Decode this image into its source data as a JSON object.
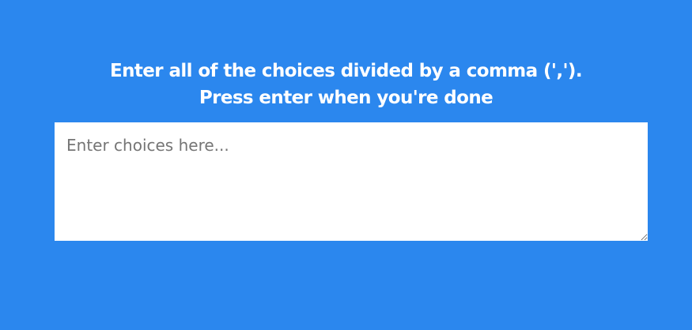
{
  "prompt": {
    "line1": "Enter all of the choices divided by a comma (',').",
    "line2": "Press enter when you're done"
  },
  "choices_input": {
    "value": "",
    "placeholder": "Enter choices here..."
  },
  "colors": {
    "background": "#2b87ee",
    "text": "#ffffff",
    "input_background": "#ffffff",
    "placeholder": "#757575"
  }
}
